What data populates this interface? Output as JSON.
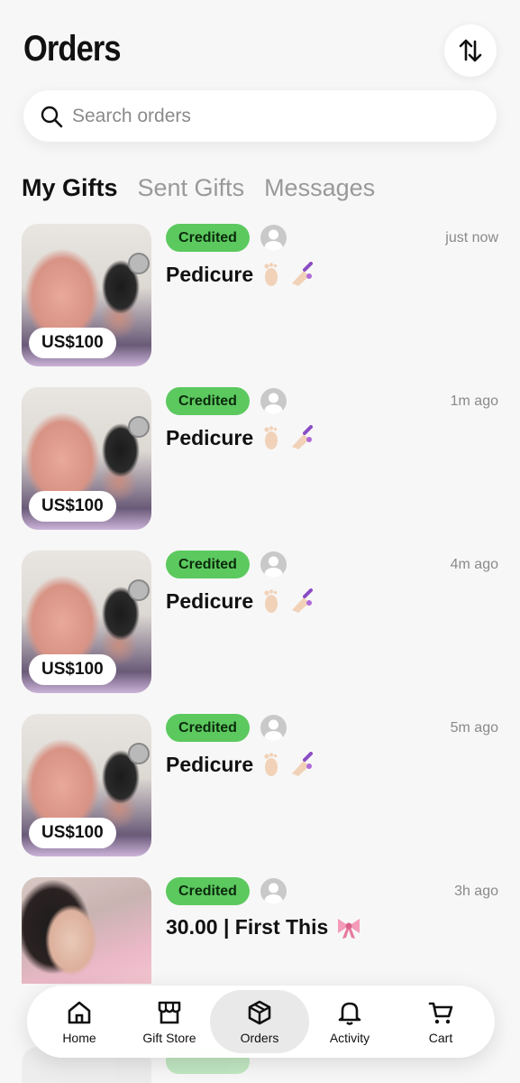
{
  "header": {
    "title": "Orders",
    "sort_icon": "sort-arrows-icon"
  },
  "search": {
    "placeholder": "Search orders",
    "icon": "search-icon"
  },
  "tabs": [
    {
      "label": "My Gifts",
      "active": true
    },
    {
      "label": "Sent Gifts",
      "active": false
    },
    {
      "label": "Messages",
      "active": false
    }
  ],
  "orders": [
    {
      "status": "Credited",
      "name": "Pedicure",
      "time": "just now",
      "price": "US$100",
      "thumb": "feet"
    },
    {
      "status": "Credited",
      "name": "Pedicure",
      "time": "1m ago",
      "price": "US$100",
      "thumb": "feet"
    },
    {
      "status": "Credited",
      "name": "Pedicure",
      "time": "4m ago",
      "price": "US$100",
      "thumb": "feet"
    },
    {
      "status": "Credited",
      "name": "Pedicure",
      "time": "5m ago",
      "price": "US$100",
      "thumb": "feet"
    },
    {
      "status": "Credited",
      "name": "30.00 |  First This",
      "time": "3h ago",
      "price": "",
      "thumb": "selfie"
    }
  ],
  "nav": [
    {
      "label": "Home",
      "icon": "home-icon",
      "active": false
    },
    {
      "label": "Gift Store",
      "icon": "store-icon",
      "active": false
    },
    {
      "label": "Orders",
      "icon": "box-icon",
      "active": true
    },
    {
      "label": "Activity",
      "icon": "bell-icon",
      "active": false
    },
    {
      "label": "Cart",
      "icon": "cart-icon",
      "active": false
    }
  ],
  "colors": {
    "accent_green": "#5cc95f",
    "background": "#f7f7f7",
    "muted_text": "#8a8a8a"
  }
}
